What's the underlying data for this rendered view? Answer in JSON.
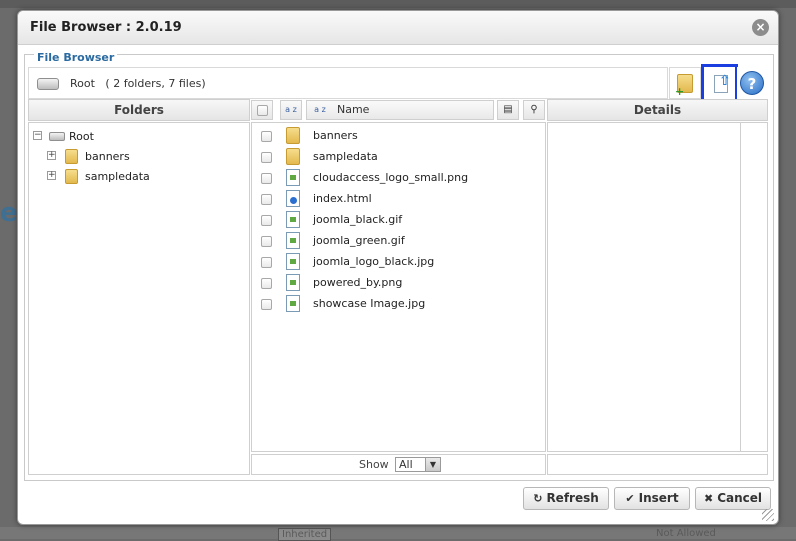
{
  "dialog": {
    "title": "File Browser : 2.0.19",
    "close_icon": "close-icon",
    "legend": "File Browser"
  },
  "path": {
    "root_label": "Root",
    "summary": "( 2 folders, 7 files)"
  },
  "toolbar": {
    "new_folder_icon": "new-folder-icon",
    "upload_icon": "upload-icon",
    "help_icon": "help-icon"
  },
  "folders_pane": {
    "header": "Folders",
    "tree": [
      {
        "label": "Root",
        "toggle": "−"
      },
      {
        "label": "banners",
        "toggle": "+"
      },
      {
        "label": "sampledata",
        "toggle": "+"
      }
    ]
  },
  "files_pane": {
    "name_header": "Name",
    "sort_label": "a z",
    "files": [
      {
        "name": "banners",
        "icon": "folder"
      },
      {
        "name": "sampledata",
        "icon": "folder"
      },
      {
        "name": "cloudaccess_logo_small.png",
        "icon": "image"
      },
      {
        "name": "index.html",
        "icon": "html"
      },
      {
        "name": "joomla_black.gif",
        "icon": "image"
      },
      {
        "name": "joomla_green.gif",
        "icon": "image"
      },
      {
        "name": "joomla_logo_black.jpg",
        "icon": "image"
      },
      {
        "name": "powered_by.png",
        "icon": "image"
      },
      {
        "name": "showcase Image.jpg",
        "icon": "image"
      }
    ],
    "show_label": "Show",
    "show_value": "All"
  },
  "details_pane": {
    "header": "Details"
  },
  "buttons": {
    "refresh": "Refresh",
    "insert": "Insert",
    "cancel": "Cancel"
  },
  "background_page": {
    "status_right": "Not Allowed",
    "select_left": "Inherited"
  }
}
